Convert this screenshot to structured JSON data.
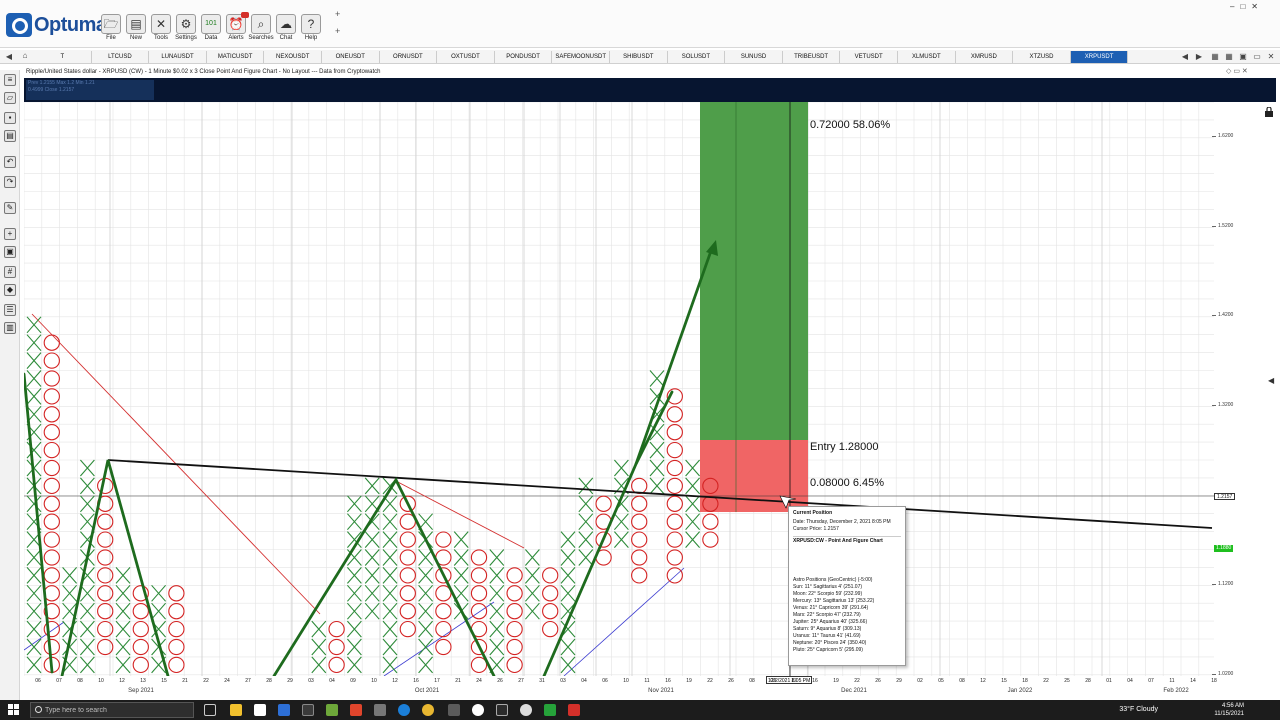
{
  "app": {
    "logo_text": "Optuma"
  },
  "toolbar": {
    "buttons": [
      {
        "label": "File",
        "icon": "folder-icon",
        "glyph": "🗁"
      },
      {
        "label": "New",
        "icon": "new-page-icon",
        "glyph": "▤"
      },
      {
        "label": "Tools",
        "icon": "tools-icon",
        "glyph": "✕"
      },
      {
        "label": "Settings",
        "icon": "gear-icon",
        "glyph": "⚙"
      },
      {
        "label": "Data",
        "icon": "data-icon",
        "glyph": "101"
      },
      {
        "label": "Alerts",
        "icon": "alarm-clock-icon",
        "glyph": "⏰"
      },
      {
        "label": "Searches",
        "icon": "search-icon",
        "glyph": "⌕"
      },
      {
        "label": "Chat",
        "icon": "chat-icon",
        "glyph": "☁"
      },
      {
        "label": "Help",
        "icon": "help-icon",
        "glyph": "?"
      }
    ]
  },
  "tabs": {
    "items": [
      "T",
      "LTCUSD",
      "LUNAUSDT",
      "MATICUSDT",
      "NEXOUSDT",
      "ONEUSDT",
      "ORNUSDT",
      "OXTUSDT",
      "PONDUSDT",
      "SAFEMOONUSDT",
      "SHIBUSDT",
      "SOLUSDT",
      "SUNUSD",
      "TRIBEUSDT",
      "VETUSDT",
      "XLMUSDT",
      "XMRUSD",
      "XTZUSD",
      "XRPUSDT"
    ],
    "active": "XRPUSDT"
  },
  "chart": {
    "title": "Ripple/United States dollar - XRPUSD (CW) - 1 Minute $0.02 x 3 Close Point And Figure Chart - No Layout --- Data from Cryptowatch",
    "header_ghost": [
      "Prev 1.2155  Max 1.2  Min 1.21",
      "0.4999  Close 1.2157"
    ]
  },
  "y_axis": {
    "labels": [
      {
        "text": "1.6200",
        "value": 1.62
      },
      {
        "text": "1.5200",
        "value": 1.52
      },
      {
        "text": "1.4200",
        "value": 1.42
      },
      {
        "text": "1.3200",
        "value": 1.32
      },
      {
        "text": "1.1200",
        "value": 1.12
      },
      {
        "text": "1.0200",
        "value": 1.02
      }
    ],
    "current_price_tag": "1.2157",
    "green_tag": "1.1880"
  },
  "x_axis": {
    "days": [
      "06",
      "07",
      "08",
      "10",
      "12",
      "13",
      "15",
      "21",
      "22",
      "24",
      "27",
      "28",
      "29",
      "03",
      "04",
      "09",
      "10",
      "12",
      "16",
      "17",
      "21",
      "24",
      "26",
      "27",
      "31",
      "03",
      "04",
      "06",
      "10",
      "11",
      "16",
      "19",
      "22",
      "26",
      "08",
      "09",
      "12",
      "16",
      "19",
      "22",
      "26",
      "29",
      "02",
      "05",
      "08",
      "12",
      "15",
      "18",
      "22",
      "25",
      "28",
      "01",
      "04",
      "07",
      "11",
      "14",
      "18"
    ],
    "months": [
      "Sep 2021",
      "Oct 2021",
      "Nov 2021",
      "Dec 2021",
      "Jan 2022",
      "Feb 2022"
    ],
    "cursor_date": "12/2/2021 8:05 PM"
  },
  "measure": {
    "target": "0.72000  58.06%",
    "entry": "Entry  1.28000",
    "risk": "0.08000  6.45%"
  },
  "popup": {
    "heading": "Current Position",
    "date": "Date: Thursday, December 2, 2021 8:05 PM",
    "cursor_price": "Cursor Price: 1.2157",
    "chart_name": "XRPUSD:CW - Point And Figure Chart",
    "astro_title": "Astro Positions (GeoCentric) (-5:00)",
    "astro": [
      "Sun: 11° Sagittarius 4' (251.07)",
      "Moon: 22° Scorpio 59' (232.99)",
      "Mercury: 13° Sagittarius 13' (253.22)",
      "Venus: 21° Capricorn 39' (291.64)",
      "Mars: 22° Scorpio 47' (232.79)",
      "Jupiter: 25° Aquarius 40' (325.66)",
      "Saturn: 9° Aquarius 8' (309.13)",
      "Uranus: 11° Taurus 41' (41.69)",
      "Neptune: 20° Pisces 24' (350.40)",
      "Pluto: 25° Capricorn 5' (295.09)"
    ]
  },
  "taskbar": {
    "search_placeholder": "Type here to search",
    "weather": "33°F  Cloudy",
    "time": "4:56 AM",
    "date": "11/15/2021"
  },
  "colors": {
    "x_mark": "#2e8b3a",
    "o_mark": "#d42323",
    "target_zone": "#4f9e4a",
    "risk_zone": "#f06565",
    "trend_line": "#1e6b1e",
    "header_bg": "#071530",
    "brand": "#1d5fb3"
  }
}
